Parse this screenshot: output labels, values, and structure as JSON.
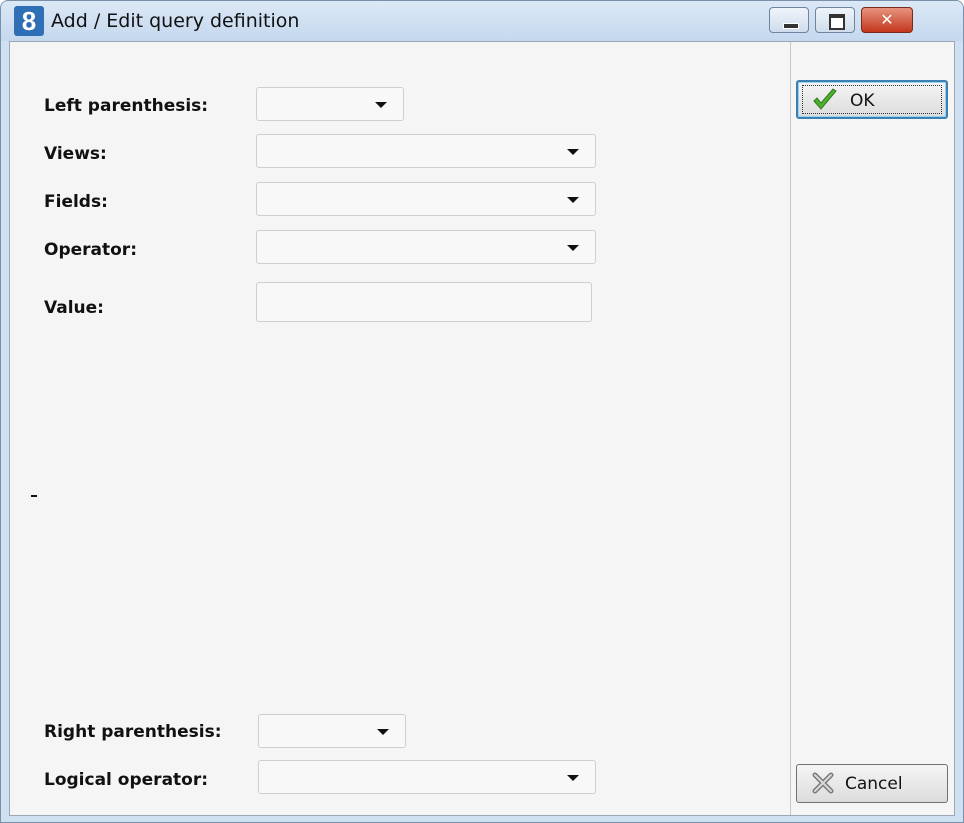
{
  "window": {
    "title": "Add / Edit query definition",
    "app_icon_glyph": "8",
    "controls": {
      "minimize": "minimize-icon",
      "maximize": "maximize-icon",
      "close": "close-icon",
      "close_glyph": "✕"
    }
  },
  "form": {
    "left_parenthesis": {
      "label": "Left parenthesis:",
      "value": ""
    },
    "views": {
      "label": "Views:",
      "value": ""
    },
    "fields": {
      "label": "Fields:",
      "value": ""
    },
    "operator": {
      "label": "Operator:",
      "value": ""
    },
    "value": {
      "label": "Value:",
      "value": ""
    },
    "right_parenthesis": {
      "label": "Right parenthesis:",
      "value": ""
    },
    "logical_operator": {
      "label": "Logical operator:",
      "value": ""
    }
  },
  "buttons": {
    "ok": {
      "label": "OK",
      "icon": "checkmark-icon"
    },
    "cancel": {
      "label": "Cancel",
      "icon": "cancel-x-icon"
    }
  },
  "colors": {
    "titlebar": "#cfe0f1",
    "client": "#f5f5f5",
    "close_button": "#c3361d",
    "check_green": "#4caf2e"
  }
}
